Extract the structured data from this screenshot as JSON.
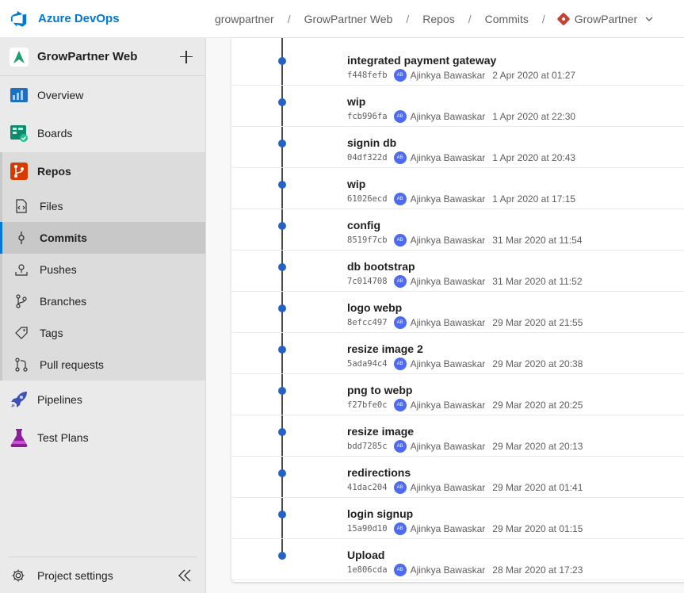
{
  "app": {
    "name": "Azure DevOps",
    "brand_color": "#0078d4"
  },
  "breadcrumb": {
    "org": "growpartner",
    "project": "GrowPartner Web",
    "section": "Repos",
    "page": "Commits",
    "repo": "GrowPartner"
  },
  "sidebar": {
    "project_name": "GrowPartner Web",
    "items": [
      {
        "label": "Overview",
        "icon": "overview-icon"
      },
      {
        "label": "Boards",
        "icon": "boards-icon"
      },
      {
        "label": "Repos",
        "icon": "repos-icon"
      },
      {
        "label": "Pipelines",
        "icon": "pipelines-icon"
      },
      {
        "label": "Test Plans",
        "icon": "test-plans-icon"
      }
    ],
    "repos_subitems": [
      {
        "label": "Files",
        "icon": "files-icon"
      },
      {
        "label": "Commits",
        "icon": "commits-icon"
      },
      {
        "label": "Pushes",
        "icon": "pushes-icon"
      },
      {
        "label": "Branches",
        "icon": "branches-icon"
      },
      {
        "label": "Tags",
        "icon": "tags-icon"
      },
      {
        "label": "Pull requests",
        "icon": "pull-requests-icon"
      }
    ],
    "active_subitem": "Commits",
    "footer_label": "Project settings"
  },
  "commits": [
    {
      "message": "integrated payment gateway",
      "sha": "f448fefb",
      "author": "Ajinkya Bawaskar",
      "initials": "AB",
      "date": "2 Apr 2020 at 01:27"
    },
    {
      "message": "wip",
      "sha": "fcb996fa",
      "author": "Ajinkya Bawaskar",
      "initials": "AB",
      "date": "1 Apr 2020 at 22:30"
    },
    {
      "message": "signin db",
      "sha": "04df322d",
      "author": "Ajinkya Bawaskar",
      "initials": "AB",
      "date": "1 Apr 2020 at 20:43"
    },
    {
      "message": "wip",
      "sha": "61026ecd",
      "author": "Ajinkya Bawaskar",
      "initials": "AB",
      "date": "1 Apr 2020 at 17:15"
    },
    {
      "message": "config",
      "sha": "8519f7cb",
      "author": "Ajinkya Bawaskar",
      "initials": "AB",
      "date": "31 Mar 2020 at 11:54"
    },
    {
      "message": "db bootstrap",
      "sha": "7c014708",
      "author": "Ajinkya Bawaskar",
      "initials": "AB",
      "date": "31 Mar 2020 at 11:52"
    },
    {
      "message": "logo webp",
      "sha": "8efcc497",
      "author": "Ajinkya Bawaskar",
      "initials": "AB",
      "date": "29 Mar 2020 at 21:55"
    },
    {
      "message": "resize image 2",
      "sha": "5ada94c4",
      "author": "Ajinkya Bawaskar",
      "initials": "AB",
      "date": "29 Mar 2020 at 20:38"
    },
    {
      "message": "png to webp",
      "sha": "f27bfe0c",
      "author": "Ajinkya Bawaskar",
      "initials": "AB",
      "date": "29 Mar 2020 at 20:25"
    },
    {
      "message": "resize image",
      "sha": "bdd7285c",
      "author": "Ajinkya Bawaskar",
      "initials": "AB",
      "date": "29 Mar 2020 at 20:13"
    },
    {
      "message": "redirections",
      "sha": "41dac204",
      "author": "Ajinkya Bawaskar",
      "initials": "AB",
      "date": "29 Mar 2020 at 01:41"
    },
    {
      "message": "login signup",
      "sha": "15a90d10",
      "author": "Ajinkya Bawaskar",
      "initials": "AB",
      "date": "29 Mar 2020 at 01:15"
    },
    {
      "message": "Upload",
      "sha": "1e806cda",
      "author": "Ajinkya Bawaskar",
      "initials": "AB",
      "date": "28 Mar 2020 at 17:23"
    }
  ]
}
